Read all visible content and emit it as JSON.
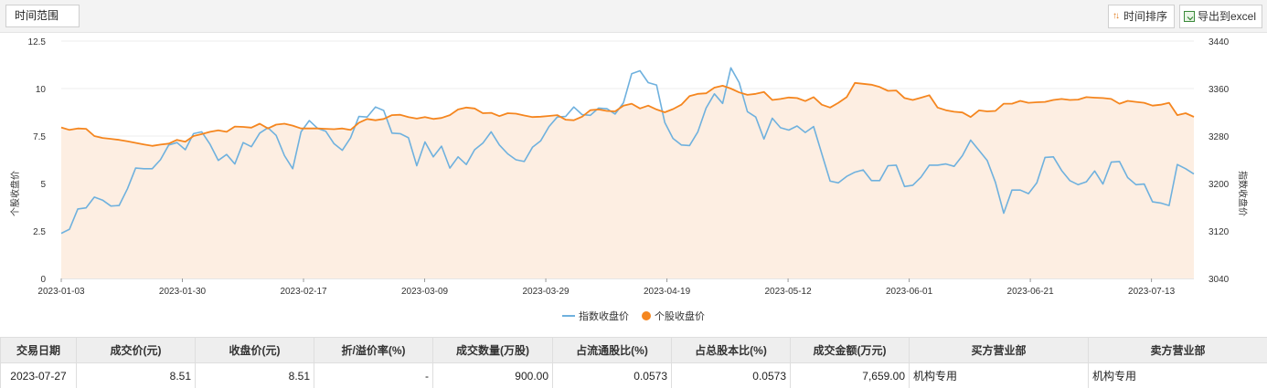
{
  "toolbar": {
    "range_label": "时间范围",
    "sort_label": "时间排序",
    "export_label": "导出到excel"
  },
  "legend": {
    "index_label": "指数收盘价",
    "stock_label": "个股收盘价"
  },
  "colors": {
    "index_line": "#6fb1de",
    "stock_line": "#f5861f",
    "stock_area": "#fdeee2"
  },
  "table": {
    "headers": [
      "交易日期",
      "成交价(元)",
      "收盘价(元)",
      "折/溢价率(%)",
      "成交数量(万股)",
      "占流通股比(%)",
      "占总股本比(%)",
      "成交金额(万元)",
      "买方营业部",
      "卖方营业部"
    ],
    "rows": [
      [
        "2023-07-27",
        "8.51",
        "8.51",
        "-",
        "900.00",
        "0.0573",
        "0.0573",
        "7,659.00",
        "机构专用",
        "机构专用"
      ]
    ]
  },
  "chart_data": {
    "type": "line",
    "left_axis": {
      "label": "个股收盘价",
      "ylim": [
        0,
        12.5
      ],
      "ticks": [
        "0",
        "2.5",
        "5",
        "7.5",
        "10",
        "12.5"
      ]
    },
    "right_axis": {
      "label": "指数收盘价",
      "ylim": [
        3040,
        3440
      ],
      "ticks": [
        "3040",
        "3120",
        "3200",
        "3280",
        "3360",
        "3440"
      ]
    },
    "x_tick_labels": [
      "2023-01-03",
      "2023-01-30",
      "2023-02-17",
      "2023-03-09",
      "2023-03-29",
      "2023-04-19",
      "2023-05-12",
      "2023-06-01",
      "2023-06-21",
      "2023-07-13"
    ],
    "grid": true,
    "legend_position": "bottom",
    "series": [
      {
        "name": "个股收盘价",
        "axis": "left",
        "values": [
          7.95,
          7.82,
          7.9,
          7.88,
          7.5,
          7.4,
          7.35,
          7.3,
          7.22,
          7.14,
          7.06,
          6.98,
          7.05,
          7.1,
          7.3,
          7.2,
          7.5,
          7.6,
          7.72,
          7.8,
          7.72,
          8.0,
          7.98,
          7.94,
          8.15,
          7.9,
          8.1,
          8.15,
          8.05,
          7.9,
          7.9,
          7.9,
          7.88,
          7.86,
          7.9,
          7.82,
          8.2,
          8.4,
          8.33,
          8.4,
          8.6,
          8.62,
          8.5,
          8.42,
          8.5,
          8.4,
          8.45,
          8.6,
          8.9,
          9.0,
          8.95,
          8.7,
          8.72,
          8.55,
          8.7,
          8.68,
          8.58,
          8.5,
          8.52,
          8.56,
          8.6,
          8.36,
          8.33,
          8.52,
          8.86,
          8.9,
          8.82,
          8.8,
          9.1,
          9.2,
          8.95,
          9.1,
          8.9,
          8.75,
          8.92,
          9.15,
          9.6,
          9.72,
          9.75,
          10.05,
          10.15,
          10.0,
          9.8,
          9.67,
          9.72,
          9.82,
          9.4,
          9.45,
          9.53,
          9.5,
          9.34,
          9.55,
          9.15,
          9.0,
          9.25,
          9.55,
          10.3,
          10.25,
          10.2,
          10.08,
          9.88,
          9.9,
          9.5,
          9.4,
          9.52,
          9.65,
          9.0,
          8.86,
          8.78,
          8.74,
          8.5,
          8.85,
          8.8,
          8.82,
          9.2,
          9.2,
          9.35,
          9.25,
          9.28,
          9.3,
          9.4,
          9.45,
          9.4,
          9.42,
          9.55,
          9.52,
          9.5,
          9.45,
          9.2,
          9.35,
          9.3,
          9.25,
          9.1,
          9.15,
          9.25,
          8.6,
          8.7,
          8.51
        ]
      },
      {
        "name": "指数收盘价",
        "axis": "right",
        "values": [
          3116,
          3123,
          3157,
          3159,
          3177,
          3172,
          3162,
          3163,
          3191,
          3226,
          3225,
          3225,
          3240,
          3265,
          3269,
          3257,
          3284,
          3287,
          3266,
          3239,
          3249,
          3233,
          3269,
          3262,
          3285,
          3294,
          3281,
          3247,
          3225,
          3287,
          3306,
          3293,
          3288,
          3267,
          3256,
          3277,
          3313,
          3312,
          3329,
          3323,
          3285,
          3284,
          3277,
          3230,
          3270,
          3245,
          3263,
          3226,
          3245,
          3232,
          3257,
          3268,
          3287,
          3265,
          3250,
          3240,
          3237,
          3261,
          3272,
          3296,
          3312,
          3313,
          3329,
          3316,
          3315,
          3327,
          3326,
          3317,
          3336,
          3385,
          3390,
          3370,
          3366,
          3303,
          3276,
          3265,
          3264,
          3287,
          3327,
          3351,
          3335,
          3395,
          3370,
          3321,
          3312,
          3275,
          3310,
          3294,
          3290,
          3297,
          3286,
          3296,
          3250,
          3204,
          3201,
          3212,
          3219,
          3223,
          3205,
          3205,
          3230,
          3231,
          3195,
          3197,
          3211,
          3231,
          3231,
          3233,
          3229,
          3247,
          3273,
          3256,
          3239,
          3202,
          3150,
          3189,
          3189,
          3183,
          3201,
          3244,
          3245,
          3222,
          3205,
          3198,
          3203,
          3221,
          3199,
          3236,
          3237,
          3210,
          3198,
          3199,
          3169,
          3167,
          3163,
          3232,
          3225,
          3216
        ]
      }
    ]
  }
}
